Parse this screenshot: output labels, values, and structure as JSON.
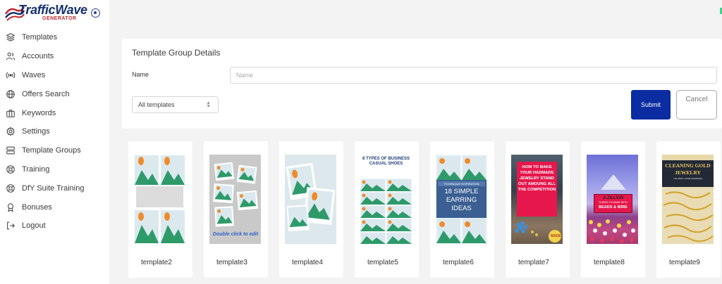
{
  "brand": {
    "title": "TrafficWave",
    "subtitle": "GENERATOR"
  },
  "sidebar": {
    "items": [
      {
        "label": "Templates",
        "icon": "layers-icon"
      },
      {
        "label": "Accounts",
        "icon": "users-icon"
      },
      {
        "label": "Waves",
        "icon": "broadcast-icon"
      },
      {
        "label": "Offers Search",
        "icon": "globe-icon"
      },
      {
        "label": "Keywords",
        "icon": "briefcase-icon"
      },
      {
        "label": "Settings",
        "icon": "gear-icon"
      },
      {
        "label": "Template Groups",
        "icon": "server-icon"
      },
      {
        "label": "Training",
        "icon": "lifebuoy-icon"
      },
      {
        "label": "DfY Suite Training",
        "icon": "lifebuoy-icon"
      },
      {
        "label": "Bonuses",
        "icon": "award-icon"
      },
      {
        "label": "Logout",
        "icon": "logout-icon"
      }
    ]
  },
  "form": {
    "title": "Template Group Details",
    "name_label": "Name",
    "name_placeholder": "Name",
    "name_value": "",
    "select_value": "All templates",
    "submit_label": "Submit",
    "cancel_label": "Cancel"
  },
  "templates": [
    {
      "name": "template2"
    },
    {
      "name": "template3",
      "caption": "Double click to edit"
    },
    {
      "name": "template4"
    },
    {
      "name": "template5",
      "headline": "8 TYPES OF BUSINESS CASUAL SHOES"
    },
    {
      "name": "template6",
      "banner": "TECHNIQUE INSPIRATION",
      "headline": "18 SIMPLE EARRING IDEAS"
    },
    {
      "name": "template7",
      "headline": "HOW TO MAKE YOUR HADMADE JEWELRY STAND OUT AMOUNG ALL THE COMPETITION",
      "badge": "MADE"
    },
    {
      "name": "template8",
      "headline_top": "A ZILLION",
      "headline_mid": "THINGS TO MAKE WITH",
      "headline_bottom": "BEADS & WIRE"
    },
    {
      "name": "template9",
      "headline": "CLEANING GOLD JEWELRY",
      "sub": "THE BEST HOME REMEDIES"
    }
  ],
  "colors": {
    "primary": "#0c2da2",
    "brand_navy": "#14306e",
    "brand_red": "#c0282e",
    "placeholder_sun": "#ef8b2c",
    "placeholder_mountain": "#2e9a6a",
    "background": "#f3f3f3"
  }
}
